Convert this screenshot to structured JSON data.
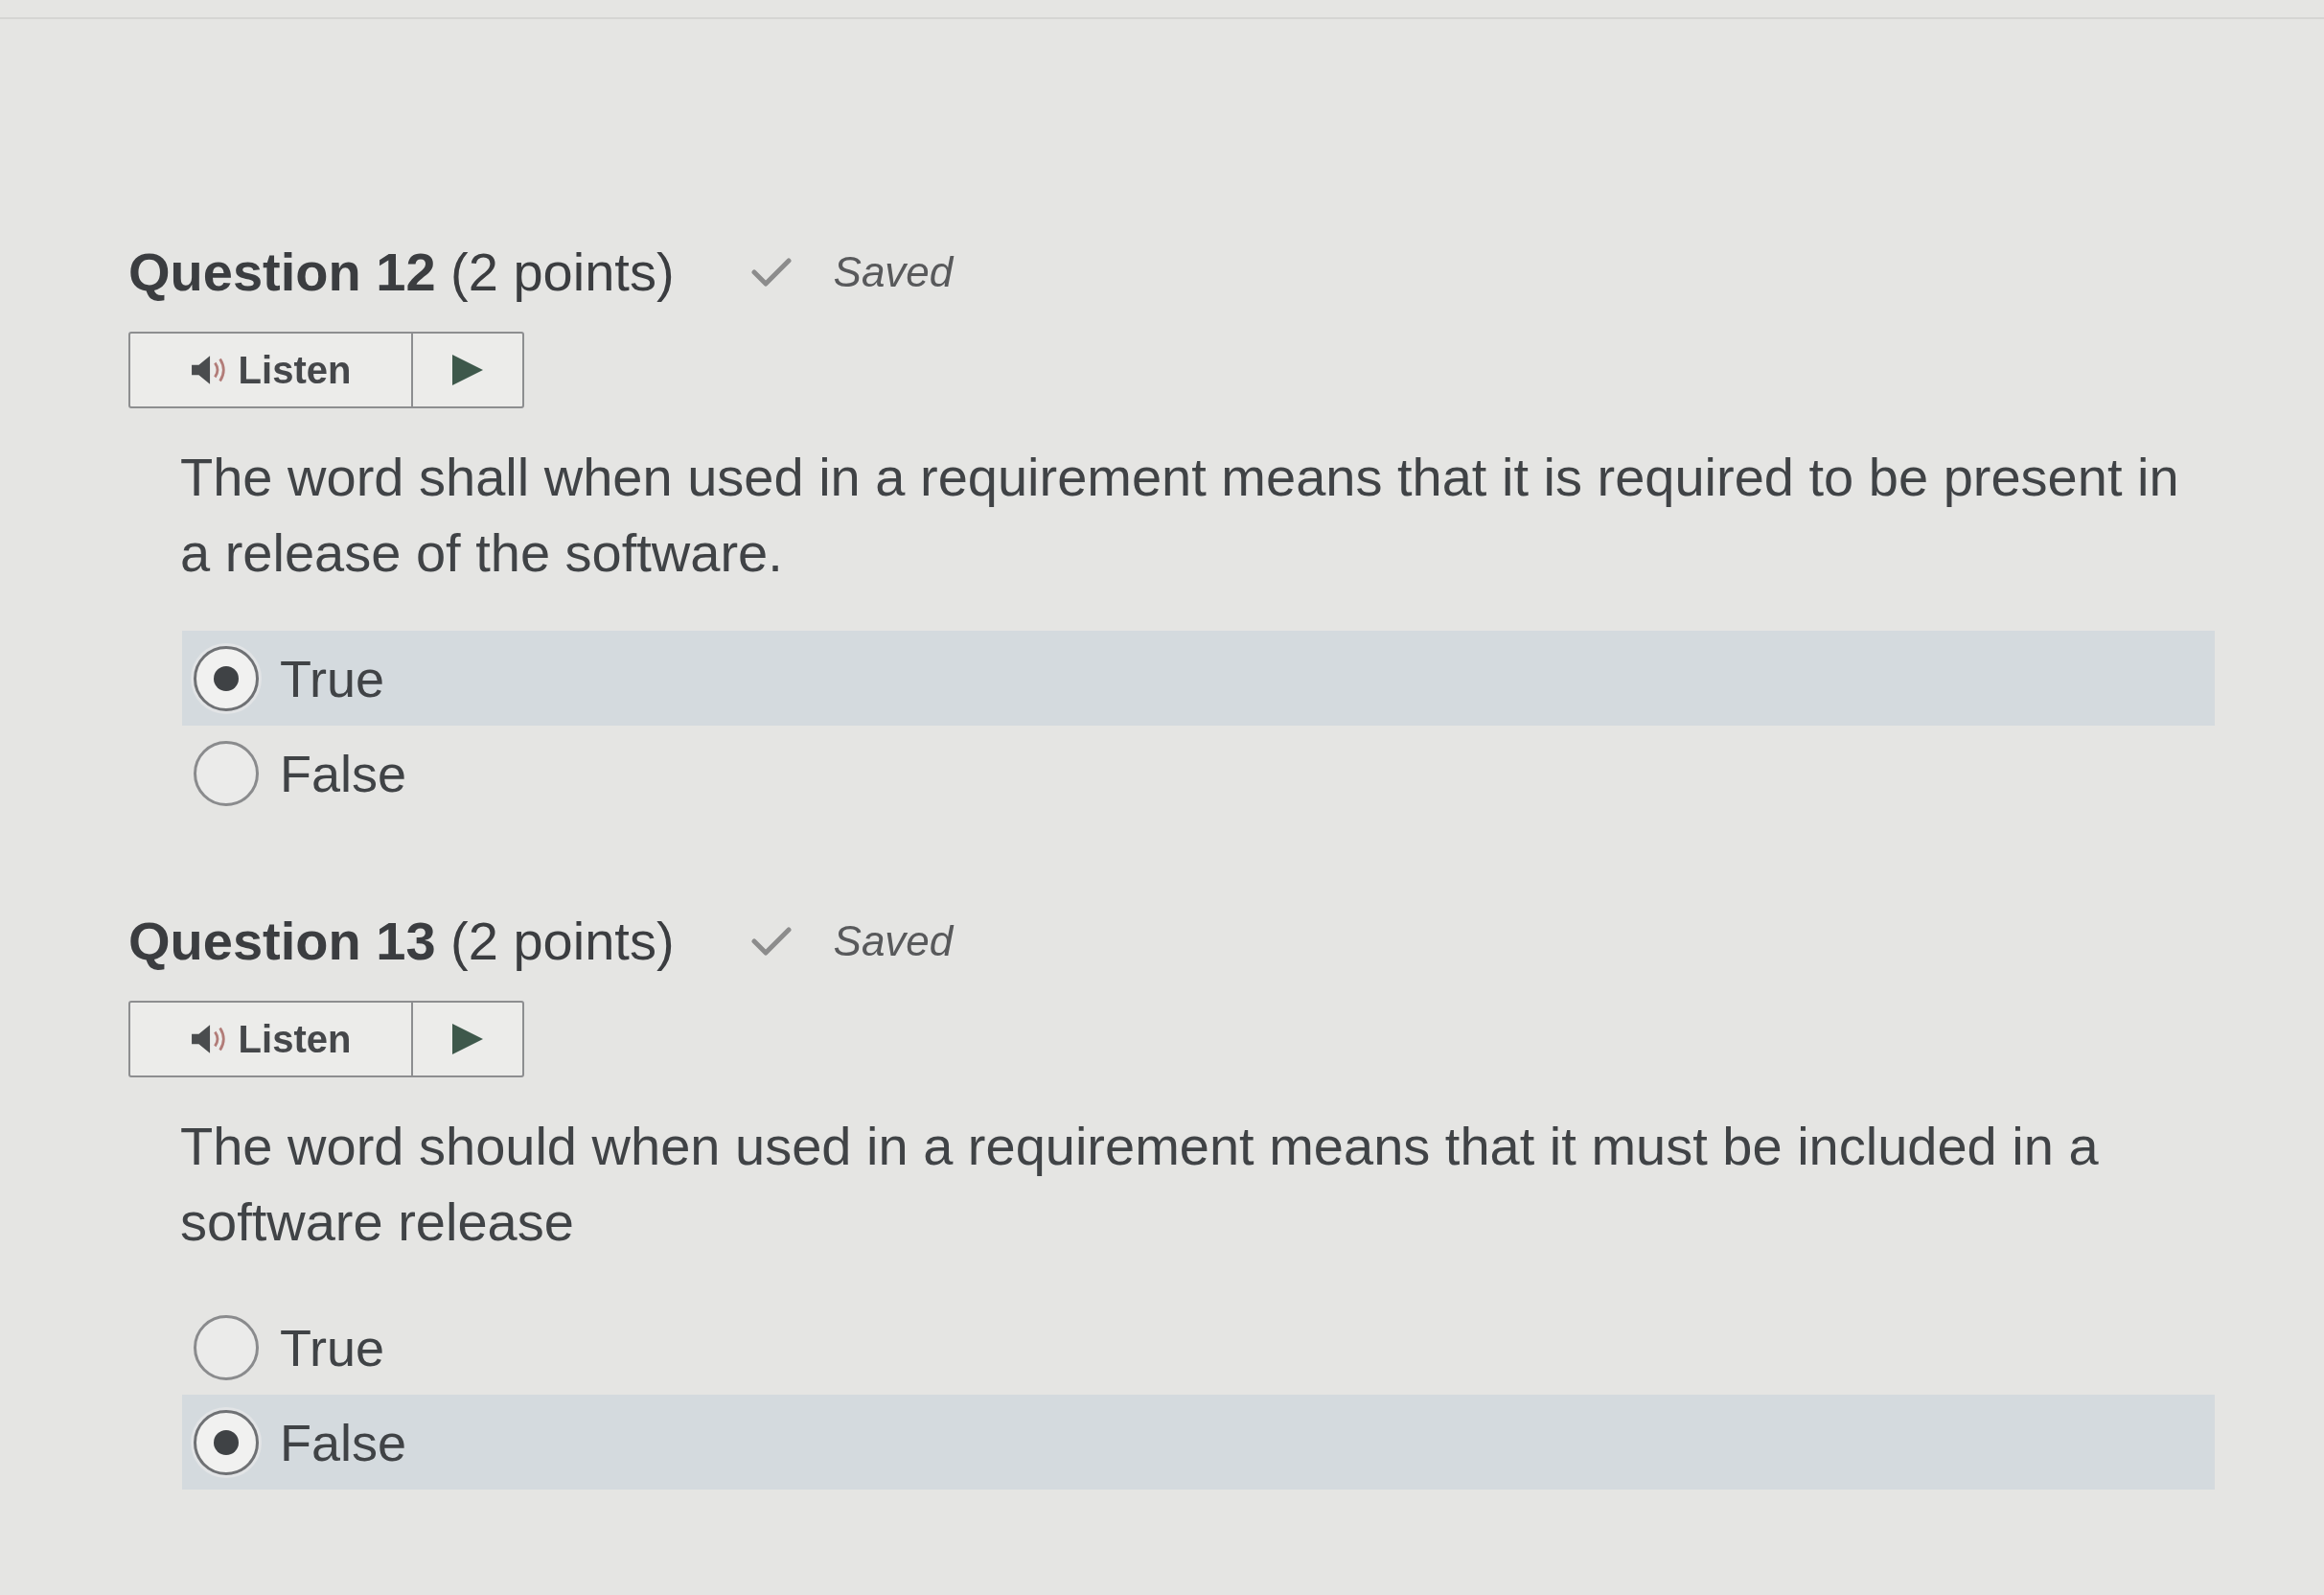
{
  "questions": [
    {
      "title": "**Question 12** (2 points)",
      "status": "Saved",
      "listen": {
        "label": "Listen"
      },
      "prompt": "The word shall when used in a requirement means that it is required to be present in a release of the software.",
      "options": [
        {
          "label": "True",
          "selected": true
        },
        {
          "label": "False",
          "selected": false
        }
      ]
    },
    {
      "title": "**Question 13** (2 points)",
      "status": "Saved",
      "listen": {
        "label": "Listen"
      },
      "prompt": "The word should when used in a requirement means that it must be included in a software release",
      "options": [
        {
          "label": "True",
          "selected": false
        },
        {
          "label": "False",
          "selected": true
        }
      ]
    }
  ]
}
